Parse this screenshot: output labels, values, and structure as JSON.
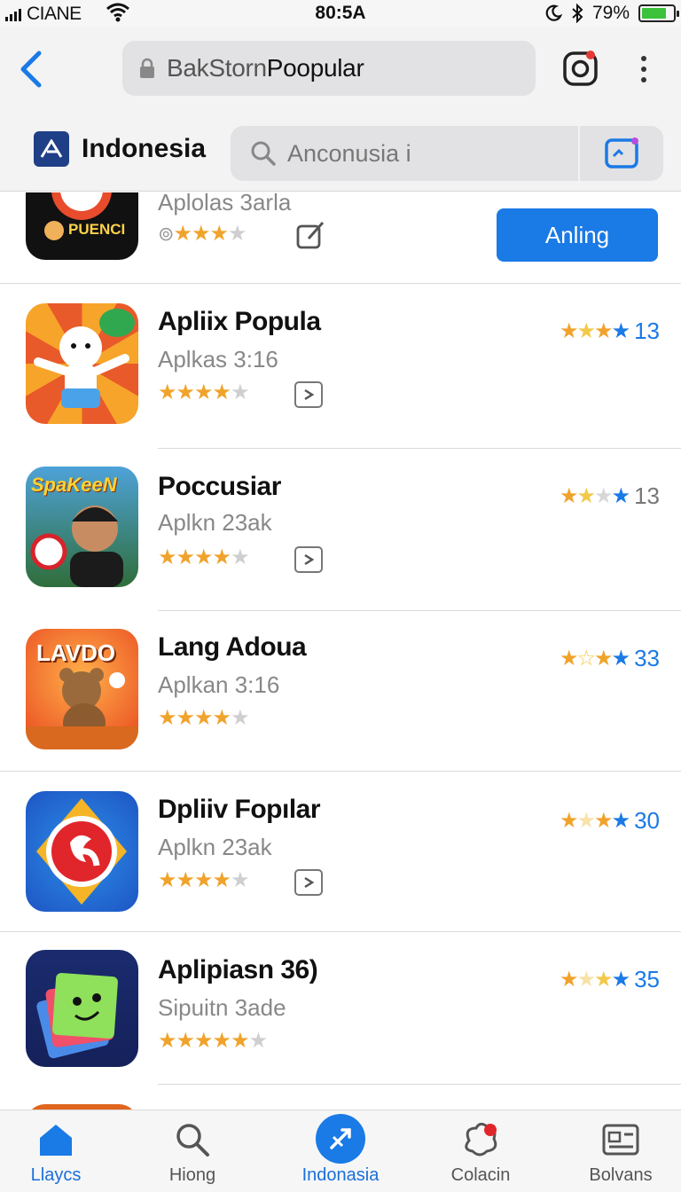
{
  "status_bar": {
    "carrier": "CIANE",
    "time": "80:5A",
    "battery": "79%",
    "battery_level": 0.79
  },
  "header": {
    "url_prefix": "BakStorn",
    "url_title": "Poopular",
    "region_name": "Indonesia",
    "search_placeholder": "Anconusia i"
  },
  "apps": [
    {
      "title": "",
      "subtitle": "Aplolas 3arla",
      "icon_label": "PUENCI",
      "rating_stars": 3,
      "action_label": "Anling"
    },
    {
      "title": "Apliix Popula",
      "subtitle": "Aplkas 3:16",
      "rating_stars": 4,
      "rating_count": "13"
    },
    {
      "title": "Poccusiar",
      "subtitle": "Aplkn 23ak",
      "icon_label": "SpaKeeN",
      "rating_stars": 4,
      "rating_count": "13"
    },
    {
      "title": "Lang Adoua",
      "subtitle": "Aplkan 3:16",
      "icon_label": "LAVDO",
      "rating_stars": 4,
      "rating_count": "33"
    },
    {
      "title": "Dpliiv Fopılar",
      "subtitle": "Aplkn 23ak",
      "rating_stars": 4,
      "rating_count": "30"
    },
    {
      "title": "Aplipiasn 36)",
      "subtitle": "Sipuitn 3ade",
      "rating_stars": 5,
      "rating_count": "35"
    }
  ],
  "tabbar": {
    "tabs": [
      {
        "label": "Llaycs",
        "icon": "home-icon"
      },
      {
        "label": "Hiong",
        "icon": "search-icon"
      },
      {
        "label": "Indonasia",
        "icon": "rocket-icon"
      },
      {
        "label": "Colacin",
        "icon": "collection-icon"
      },
      {
        "label": "Bolvans",
        "icon": "profile-icon"
      }
    ]
  },
  "colors": {
    "accent": "#1a7ae6",
    "star": "#f0a32c",
    "star_off": "#cfcfd2"
  }
}
